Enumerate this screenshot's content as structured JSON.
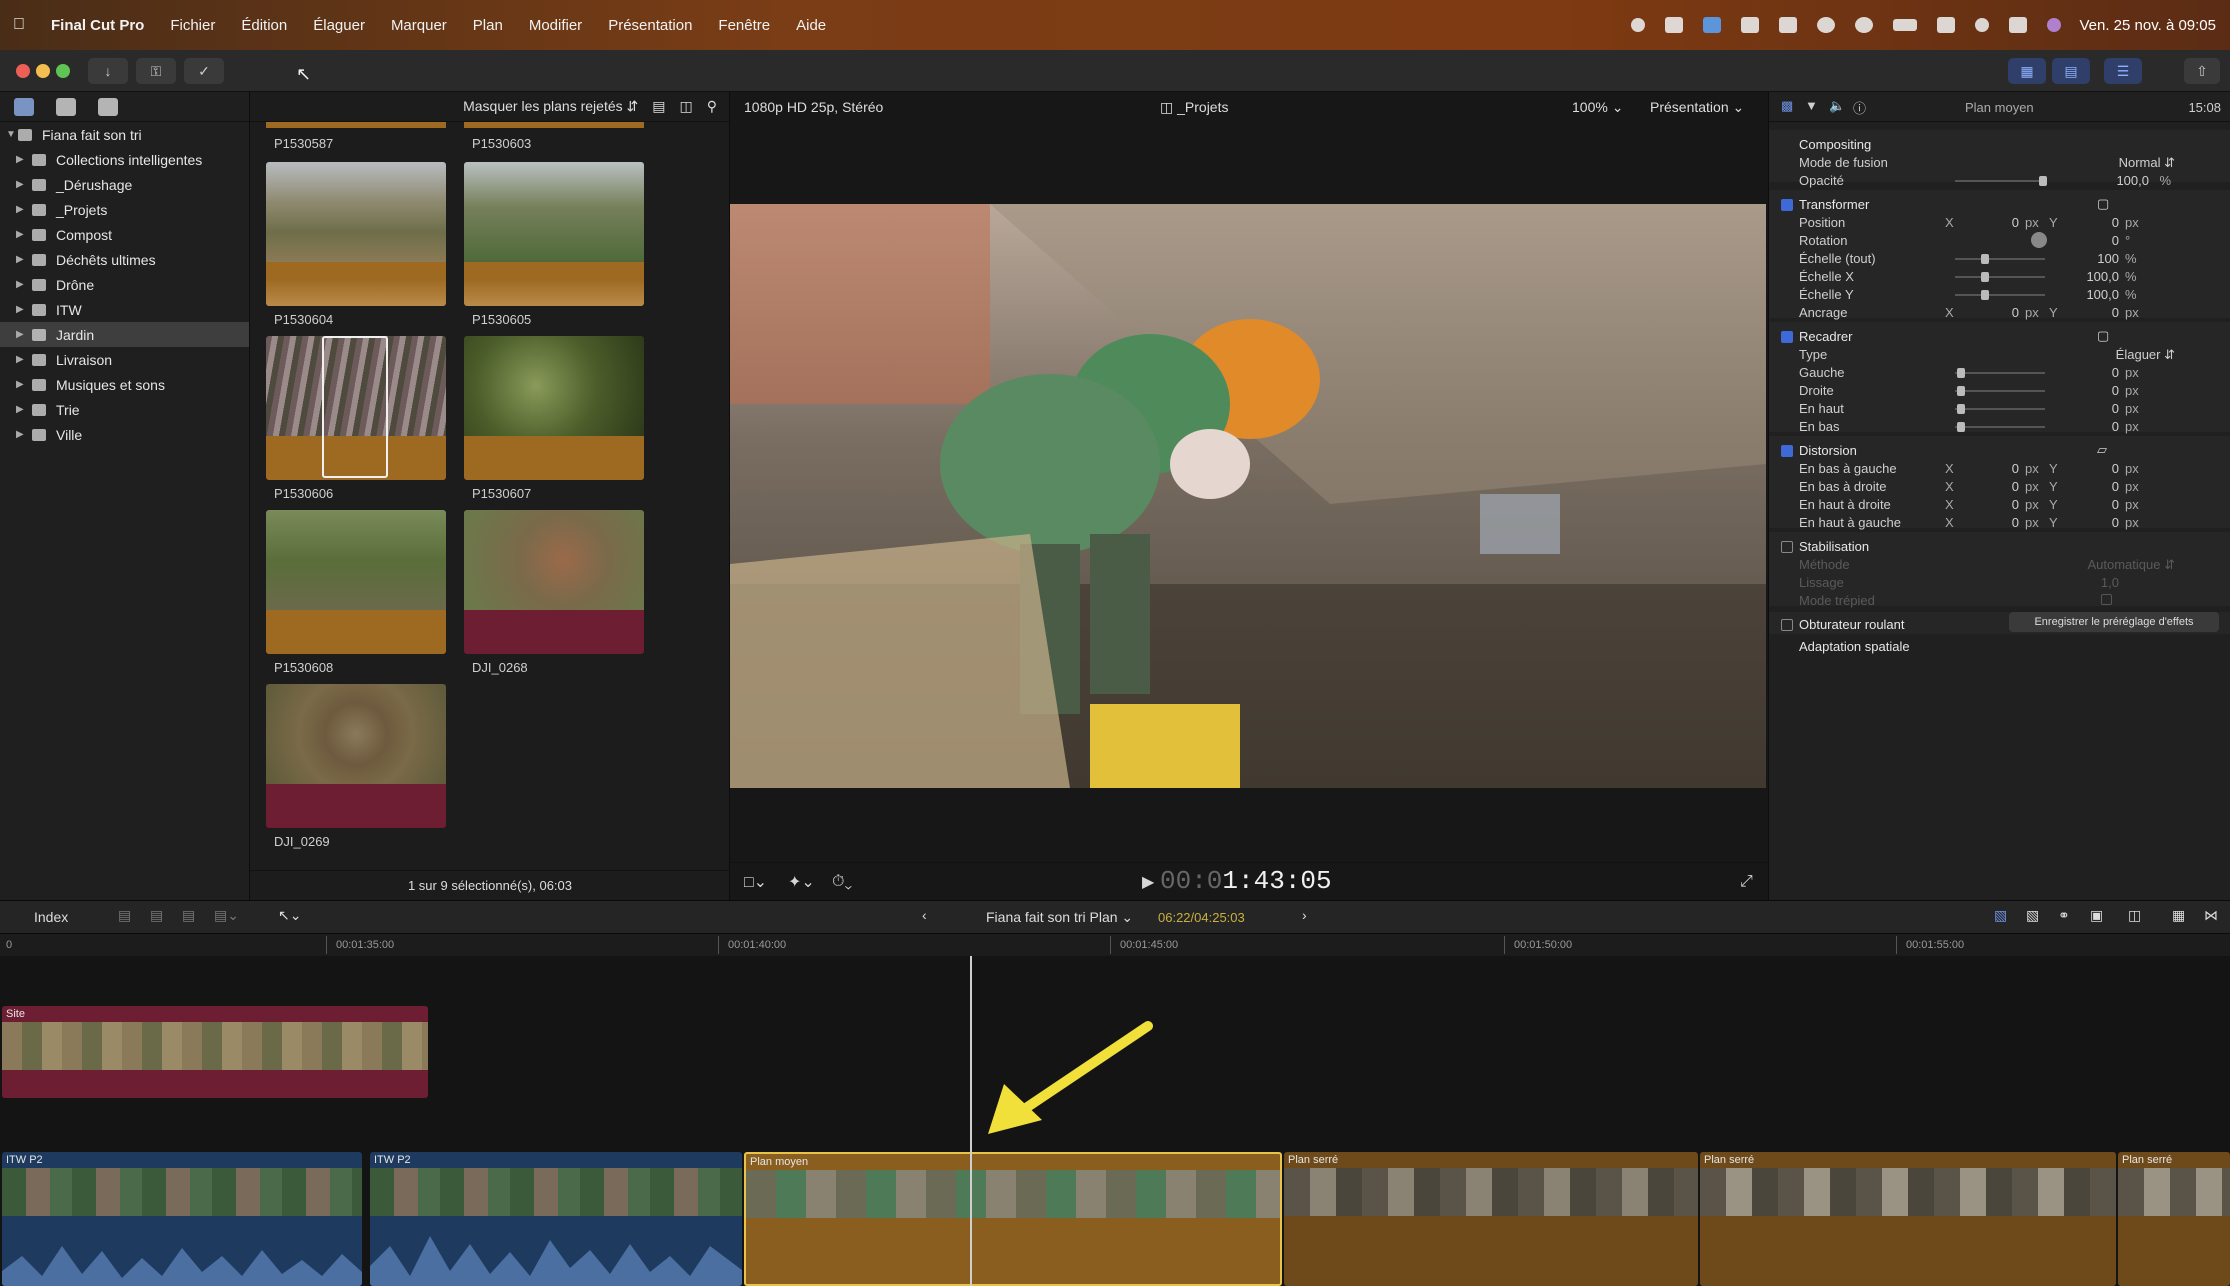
{
  "menubar": {
    "app_name": "Final Cut Pro",
    "items": [
      "Fichier",
      "Édition",
      "Élaguer",
      "Marquer",
      "Plan",
      "Modifier",
      "Présentation",
      "Fenêtre",
      "Aide"
    ],
    "clock": "Ven. 25 nov. à 09:05"
  },
  "sidebar": {
    "root": "Fiana fait son tri",
    "items": [
      {
        "label": "Collections intelligentes",
        "icon": "folder-icon"
      },
      {
        "label": "_Dérushage",
        "icon": "event-icon"
      },
      {
        "label": "_Projets",
        "icon": "event-icon"
      },
      {
        "label": "Compost",
        "icon": "event-icon"
      },
      {
        "label": "Déchêts ultimes",
        "icon": "event-icon"
      },
      {
        "label": "Drône",
        "icon": "event-icon"
      },
      {
        "label": "ITW",
        "icon": "event-icon"
      },
      {
        "label": "Jardin",
        "icon": "event-icon",
        "selected": true
      },
      {
        "label": "Livraison",
        "icon": "event-icon"
      },
      {
        "label": "Musiques et sons",
        "icon": "event-icon"
      },
      {
        "label": "Trie",
        "icon": "event-icon"
      },
      {
        "label": "Ville",
        "icon": "event-icon"
      }
    ]
  },
  "browser": {
    "filter": "Masquer les plans rejetés",
    "clips": [
      "P1530587",
      "P1530603",
      "P1530604",
      "P1530605",
      "P1530606",
      "P1530607",
      "P1530608",
      "DJI_0268",
      "DJI_0269"
    ],
    "footer": "1 sur 9 sélectionné(s), 06:03"
  },
  "viewer": {
    "format": "1080p HD 25p, Stéréo",
    "project": "_Projets",
    "zoom": "100%",
    "display": "Présentation",
    "timecode_dim": "00:0",
    "timecode": "1:43:05"
  },
  "inspector": {
    "header": "Plan moyen",
    "duration": "15:08",
    "rows": {
      "compositing": "Compositing",
      "blend_mode_label": "Mode de fusion",
      "blend_mode": "Normal",
      "opacity_label": "Opacité",
      "opacity": "100,0",
      "transform": "Transformer",
      "position": "Position",
      "rotation": "Rotation",
      "scale_all": "Échelle (tout)",
      "scale_x": "Échelle X",
      "scale_y": "Échelle Y",
      "anchor": "Ancrage",
      "crop": "Recadrer",
      "type_label": "Type",
      "type_value": "Élaguer",
      "left": "Gauche",
      "right": "Droite",
      "top": "En haut",
      "bottom": "En bas",
      "distort": "Distorsion",
      "bl": "En bas à gauche",
      "br": "En bas à droite",
      "tr": "En haut à droite",
      "tl": "En haut à gauche",
      "stabilization": "Stabilisation",
      "method_label": "Méthode",
      "method": "Automatique",
      "smoothing_label": "Lissage",
      "smoothing": "1,0",
      "tripod": "Mode trépied",
      "rolling": "Obturateur roulant",
      "spatial": "Adaptation spatiale",
      "save_preset": "Enregistrer le préréglage d'effets"
    },
    "values": {
      "zero": "0",
      "px": "px",
      "pct": "%",
      "deg": "°",
      "x": "X",
      "y": "Y",
      "hundred": "100",
      "hundred_dec": "100,0"
    }
  },
  "timeline": {
    "index": "Index",
    "project": "Fiana fait son tri Plan",
    "duration": "06:22/04:25:03",
    "ruler": [
      "00:01:35:00",
      "00:01:40:00",
      "00:01:45:00",
      "00:01:50:00",
      "00:01:55:00"
    ],
    "ruler_start": "0",
    "clips": [
      {
        "title": "Site"
      },
      {
        "title": "ITW P2"
      },
      {
        "title": "ITW P2"
      },
      {
        "title": "Plan moyen"
      },
      {
        "title": "Plan serré"
      },
      {
        "title": "Plan serré"
      },
      {
        "title": "Plan serré"
      }
    ]
  },
  "colors": {
    "accent": "#3d6ad6",
    "audio": "#9e6a22",
    "video_clip": "#6e1e32",
    "selected_border": "#e8c34a",
    "arrow": "#f2e03a"
  }
}
